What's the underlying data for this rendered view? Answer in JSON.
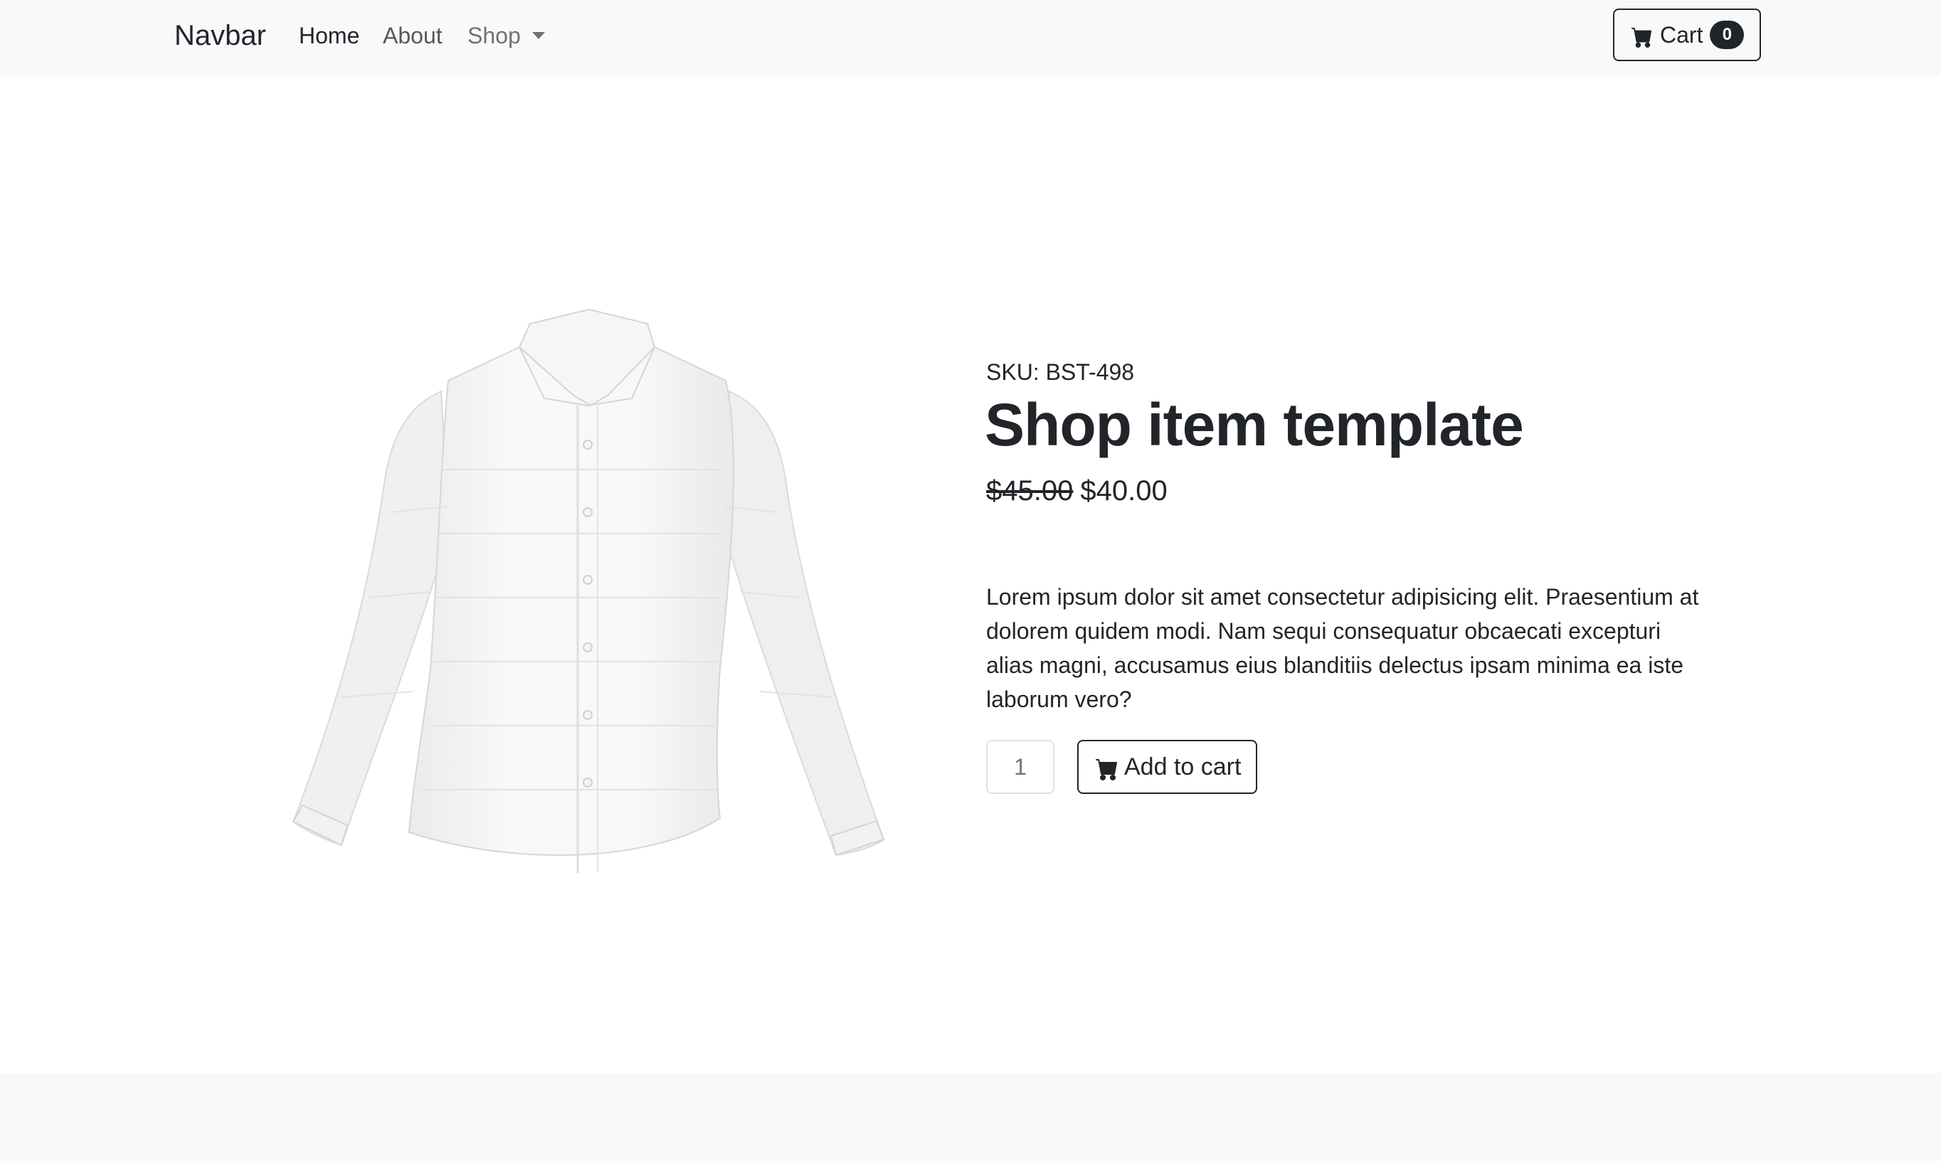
{
  "navbar": {
    "brand": "Navbar",
    "links": [
      {
        "label": "Home"
      },
      {
        "label": "About"
      },
      {
        "label": "Shop"
      }
    ],
    "cart": {
      "label": "Cart",
      "count": "0"
    }
  },
  "product": {
    "sku": "SKU: BST-498",
    "title": "Shop item template",
    "old_price": "$45.00",
    "price": "$40.00",
    "description": "Lorem ipsum dolor sit amet consectetur adipisicing elit. Praesentium at dolorem quidem modi. Nam sequi consequatur obcaecati excepturi alias magni, accusamus eius blanditiis delectus ipsam minima ea iste laborum vero?",
    "quantity": "1",
    "add_to_cart_label": "Add to cart",
    "image": "white-shirt"
  },
  "colors": {
    "navbar_bg": "#f8f9fa",
    "text": "#212529",
    "badge_bg": "#212529"
  },
  "icons": {
    "cart": "cart-icon",
    "dropdown": "chevron-down-icon"
  }
}
